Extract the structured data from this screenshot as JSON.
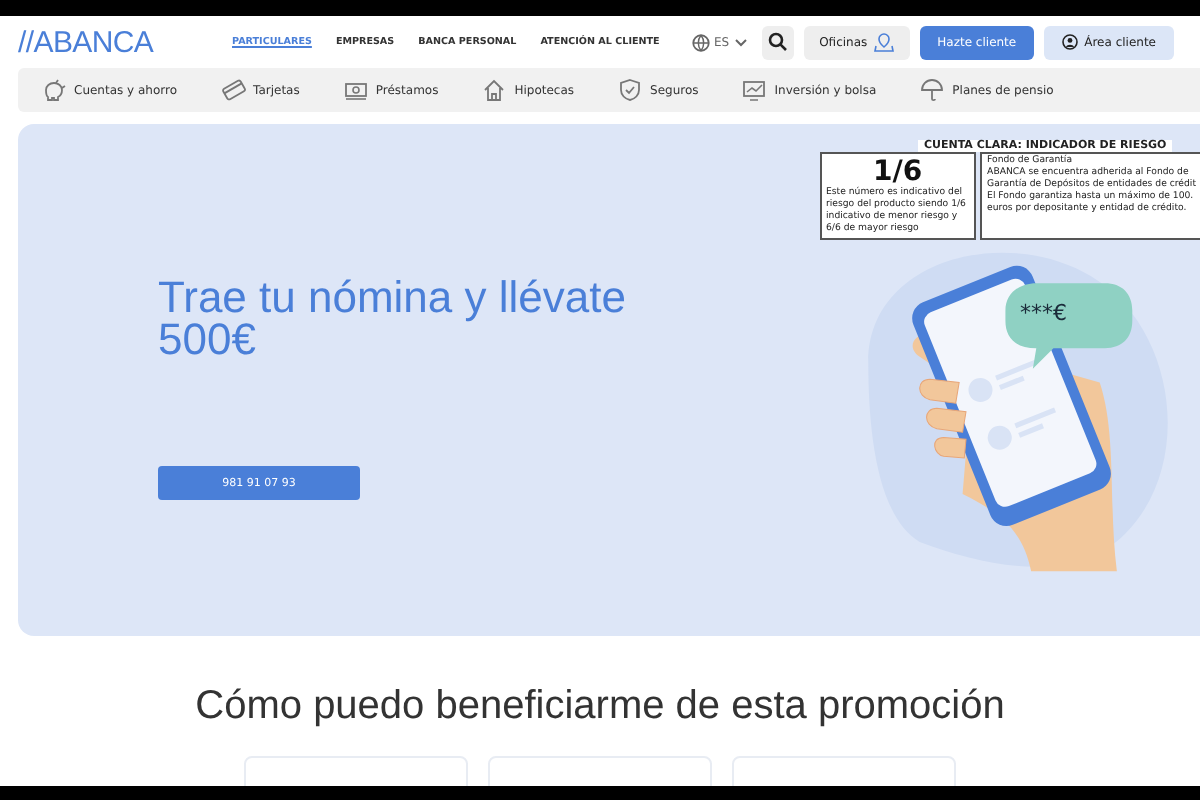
{
  "header": {
    "logo": "//ABANCA",
    "nav": [
      {
        "label": "PARTICULARES",
        "selected": true
      },
      {
        "label": "EMPRESAS",
        "selected": false
      },
      {
        "label": "BANCA PERSONAL",
        "selected": false
      },
      {
        "label": "ATENCIÓN AL CLIENTE",
        "selected": false
      }
    ],
    "language": "ES",
    "offices_button": "Oficinas",
    "signup_button": "Hazte cliente",
    "client_area_button": "Área cliente"
  },
  "categories": [
    {
      "label": "Cuentas y ahorro",
      "kind": "piggy"
    },
    {
      "label": "Tarjetas",
      "kind": "card"
    },
    {
      "label": "Préstamos",
      "kind": "money"
    },
    {
      "label": "Hipotecas",
      "kind": "house"
    },
    {
      "label": "Seguros",
      "kind": "shield"
    },
    {
      "label": "Inversión y bolsa",
      "kind": "chart"
    },
    {
      "label": "Planes de pensio",
      "kind": "umbrella"
    }
  ],
  "hero": {
    "title": "Trae tu nómina y llévate 500€",
    "phone_button": "981 91 07 93",
    "bubble_text": "***€"
  },
  "risk_indicator": {
    "heading": "CUENTA CLARA: INDICADOR DE RIESGO",
    "score": "1/6",
    "score_note": "Este número es indicativo del riesgo del producto siendo 1/6 indicativo de menor riesgo y 6/6 de mayor riesgo",
    "guarantee_lines": [
      "Fondo de Garantía",
      "ABANCA se encuentra adherida al Fondo de",
      "Garantía de Depósitos de entidades de crédit",
      "El Fondo garantiza hasta un máximo de 100.",
      "euros por depositante y entidad de crédito."
    ]
  },
  "benefits": {
    "title": "Cómo puedo beneficiarme de esta promoción"
  }
}
